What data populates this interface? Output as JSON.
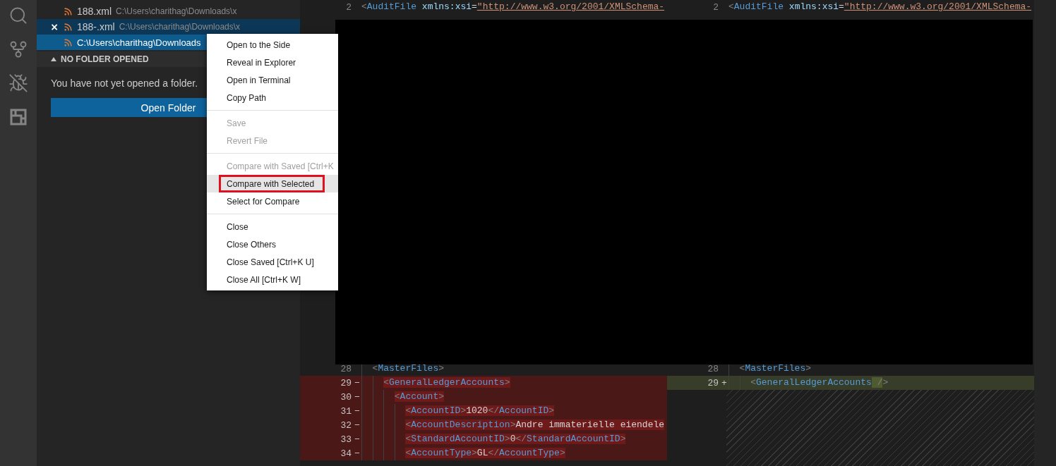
{
  "open_editors": [
    {
      "name": "188.xml",
      "path": "C:\\Users\\charithag\\Downloads\\x",
      "hovered": false,
      "selected": false
    },
    {
      "close": "×",
      "name": "188-.xml",
      "path": "C:\\Users\\charithag\\Downloads\\x",
      "hovered": true,
      "selected": false
    },
    {
      "path": "C:\\Users\\charithag\\Downloads",
      "hovered": false,
      "selected": true
    }
  ],
  "explorer_section": {
    "title": "NO FOLDER OPENED",
    "expanded": true,
    "message": "You have not yet opened a folder.",
    "button": "Open Folder"
  },
  "context_menu": {
    "groups": [
      [
        {
          "label": "Open to the Side",
          "disabled": false,
          "highlighted": false
        },
        {
          "label": "Reveal in Explorer",
          "disabled": false,
          "highlighted": false
        },
        {
          "label": "Open in Terminal",
          "disabled": false,
          "highlighted": false
        },
        {
          "label": "Copy Path",
          "disabled": false,
          "highlighted": false
        }
      ],
      [
        {
          "label": "Save",
          "disabled": true,
          "highlighted": false
        },
        {
          "label": "Revert File",
          "disabled": true,
          "highlighted": false
        }
      ],
      [
        {
          "label": "Compare with Saved [Ctrl+K",
          "disabled": true,
          "highlighted": false
        },
        {
          "label": "Compare with Selected",
          "disabled": false,
          "highlighted": true
        },
        {
          "label": "Select for Compare",
          "disabled": false,
          "highlighted": false
        }
      ],
      [
        {
          "label": "Close",
          "disabled": false,
          "highlighted": false
        },
        {
          "label": "Close Others",
          "disabled": false,
          "highlighted": false
        },
        {
          "label": "Close Saved [Ctrl+K U]",
          "disabled": false,
          "highlighted": false
        },
        {
          "label": "Close All [Ctrl+K W]",
          "disabled": false,
          "highlighted": false
        }
      ]
    ]
  },
  "diff_editor": {
    "panes": [
      {
        "hatched_filler": false,
        "lines": [
          {
            "number": "2",
            "kind": "unchanged",
            "tokens": [
              {
                "kind": "punct",
                "text": "<"
              },
              {
                "kind": "tag",
                "text": "AuditFile"
              },
              {
                "kind": "attr",
                "text": " xmlns:xsi"
              },
              {
                "kind": "text",
                "text": "="
              },
              {
                "kind": "string",
                "text": "\"http://www.w3.org/2001/XMLSchema-"
              }
            ],
            "children": [
              {
                "number": "28",
                "kind": "unchanged",
                "tokens": [
                  {
                    "kind": "punct",
                    "text": "<"
                  },
                  {
                    "kind": "tag",
                    "text": "MasterFiles"
                  },
                  {
                    "kind": "punct",
                    "text": ">"
                  }
                ],
                "children": [
                  {
                    "number": "29",
                    "marker": "−",
                    "kind": "removed",
                    "tokens": [
                      {
                        "kind": "punct",
                        "text": "<",
                        "changed": true
                      },
                      {
                        "kind": "tag",
                        "text": "GeneralLedgerAccounts",
                        "changed": true
                      },
                      {
                        "kind": "punct",
                        "text": ">",
                        "changed": true
                      }
                    ],
                    "children": [
                      {
                        "number": "30",
                        "marker": "−",
                        "kind": "removed",
                        "tokens": [
                          {
                            "kind": "punct",
                            "text": "<",
                            "changed": true
                          },
                          {
                            "kind": "tag",
                            "text": "Account",
                            "changed": true
                          },
                          {
                            "kind": "punct",
                            "text": ">",
                            "changed": true
                          }
                        ],
                        "children": [
                          {
                            "number": "31",
                            "marker": "−",
                            "kind": "removed",
                            "tokens": [
                              {
                                "kind": "punct",
                                "text": "<",
                                "changed": true
                              },
                              {
                                "kind": "tag",
                                "text": "AccountID",
                                "changed": true
                              },
                              {
                                "kind": "punct",
                                "text": ">",
                                "changed": true
                              },
                              {
                                "kind": "text",
                                "text": "1020",
                                "changed": true
                              },
                              {
                                "kind": "punct",
                                "text": "</",
                                "changed": true
                              },
                              {
                                "kind": "tag",
                                "text": "AccountID",
                                "changed": true
                              },
                              {
                                "kind": "punct",
                                "text": ">",
                                "changed": true
                              }
                            ]
                          },
                          {
                            "number": "32",
                            "marker": "−",
                            "kind": "removed",
                            "tokens": [
                              {
                                "kind": "punct",
                                "text": "<",
                                "changed": true
                              },
                              {
                                "kind": "tag",
                                "text": "AccountDescription",
                                "changed": true
                              },
                              {
                                "kind": "punct",
                                "text": ">",
                                "changed": true
                              },
                              {
                                "kind": "text",
                                "text": "Andre immaterielle eiendele",
                                "changed": true
                              }
                            ]
                          },
                          {
                            "number": "33",
                            "marker": "−",
                            "kind": "removed",
                            "tokens": [
                              {
                                "kind": "punct",
                                "text": "<",
                                "changed": true
                              },
                              {
                                "kind": "tag",
                                "text": "StandardAccountID",
                                "changed": true
                              },
                              {
                                "kind": "punct",
                                "text": ">",
                                "changed": true
                              },
                              {
                                "kind": "text",
                                "text": "0",
                                "changed": true
                              },
                              {
                                "kind": "punct",
                                "text": "</",
                                "changed": true
                              },
                              {
                                "kind": "tag",
                                "text": "StandardAccountID",
                                "changed": true
                              },
                              {
                                "kind": "punct",
                                "text": ">",
                                "changed": true
                              }
                            ]
                          },
                          {
                            "number": "34",
                            "marker": "−",
                            "kind": "removed",
                            "tokens": [
                              {
                                "kind": "punct",
                                "text": "<",
                                "changed": true
                              },
                              {
                                "kind": "tag",
                                "text": "AccountType",
                                "changed": true
                              },
                              {
                                "kind": "punct",
                                "text": ">",
                                "changed": true
                              },
                              {
                                "kind": "text",
                                "text": "GL",
                                "changed": true
                              },
                              {
                                "kind": "punct",
                                "text": "</",
                                "changed": true
                              },
                              {
                                "kind": "tag",
                                "text": "AccountType",
                                "changed": true
                              },
                              {
                                "kind": "punct",
                                "text": ">",
                                "changed": true
                              }
                            ]
                          }
                        ]
                      }
                    ]
                  }
                ]
              }
            ]
          }
        ]
      },
      {
        "hatched_filler": true,
        "lines": [
          {
            "number": "2",
            "kind": "unchanged",
            "tokens": [
              {
                "kind": "punct",
                "text": "<"
              },
              {
                "kind": "tag",
                "text": "AuditFile"
              },
              {
                "kind": "attr",
                "text": " xmlns:xsi"
              },
              {
                "kind": "text",
                "text": "="
              },
              {
                "kind": "string",
                "text": "\"http://www.w3.org/2001/XMLSchema-"
              }
            ],
            "children": [
              {
                "number": "28",
                "kind": "unchanged",
                "tokens": [
                  {
                    "kind": "punct",
                    "text": "<"
                  },
                  {
                    "kind": "tag",
                    "text": "MasterFiles"
                  },
                  {
                    "kind": "punct",
                    "text": ">"
                  }
                ],
                "children": [
                  {
                    "number": "29",
                    "marker": "+",
                    "kind": "added",
                    "tokens": [
                      {
                        "kind": "punct",
                        "text": "<"
                      },
                      {
                        "kind": "tag",
                        "text": "GeneralLedgerAccounts"
                      },
                      {
                        "kind": "punct",
                        "text": " /",
                        "changed": true
                      },
                      {
                        "kind": "punct",
                        "text": ">"
                      }
                    ]
                  }
                ]
              }
            ]
          }
        ]
      }
    ]
  },
  "redaction": {
    "covered": true
  }
}
